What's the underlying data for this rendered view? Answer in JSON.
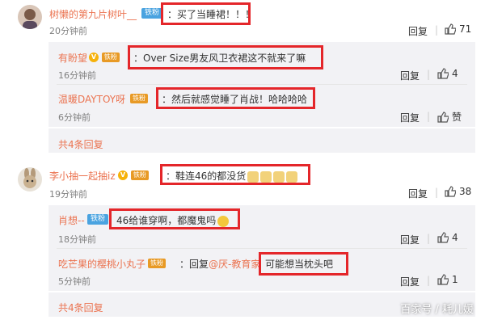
{
  "comments": [
    {
      "user": "树懒的第九片树叶__",
      "badge": "铁粉",
      "text": "：买了当睡裙！！！",
      "time": "20分钟前",
      "reply_label": "回复",
      "like_count": "71",
      "replies": [
        {
          "user": "有盼望",
          "badge": "铁粉",
          "text": "：Over Size男友风卫衣裙这不就来了嘛",
          "time": "16分钟前",
          "reply_label": "回复",
          "like_count": "4"
        },
        {
          "user": "温暖DAYTOY呀",
          "badge": "铁粉",
          "text": "：然后就感觉睡了肖战！哈哈哈哈",
          "time": "6分钟前",
          "reply_label": "回复",
          "like_count": "赞"
        }
      ],
      "more": "共4条回复"
    },
    {
      "user": "李小抽一起抽iz",
      "badge": "铁粉",
      "text": "：鞋连46的都没货",
      "time": "19分钟前",
      "reply_label": "回复",
      "like_count": "38",
      "replies": [
        {
          "user": "肖想--",
          "badge": "铁粉",
          "text": "46给谁穿啊，都魔鬼吗",
          "time": "18分钟前",
          "reply_label": "回复",
          "like_count": "4"
        },
        {
          "user": "吃芒果的樱桃小丸子",
          "badge": "铁粉",
          "text_prefix": "：回复",
          "mention": "@厌-教育家",
          "text": "可能想当枕头吧",
          "time": "5分钟前",
          "reply_label": "回复",
          "like_count": "1"
        }
      ],
      "more": "共4条回复"
    }
  ],
  "watermark": "百家号 / 耗儿媛",
  "colors": {
    "username": "#eb7350",
    "highlight_box": "#e4262a",
    "reply_bg": "#f2f2f5"
  },
  "icons": [
    "verified-icon",
    "fan-badge-icon",
    "like-thumb-icon",
    "emoji-icon"
  ]
}
